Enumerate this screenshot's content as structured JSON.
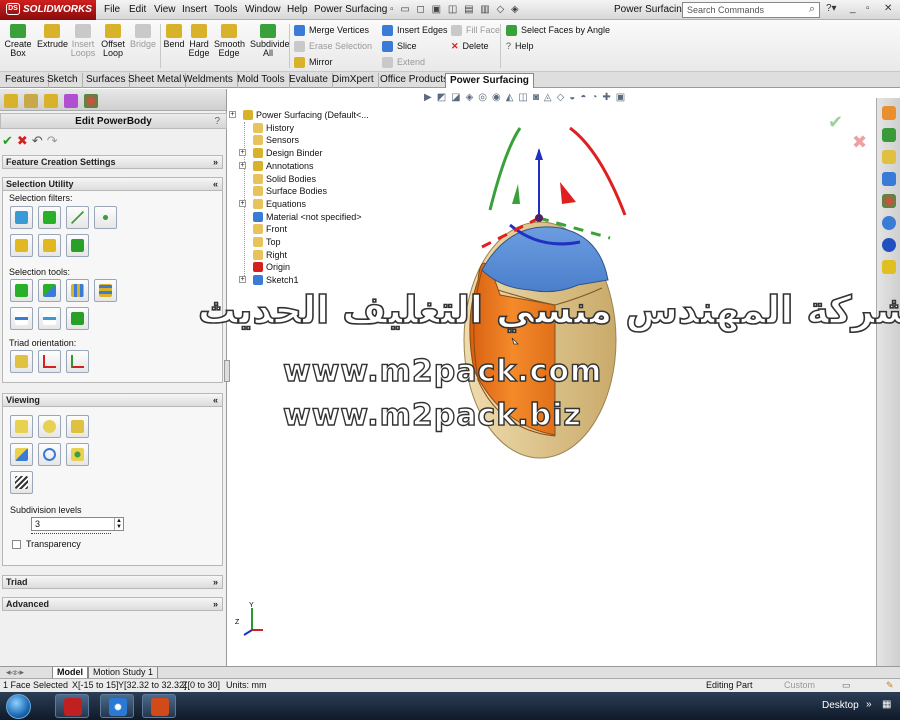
{
  "app": {
    "logo_text": "SOLIDWORKS",
    "document_title": "Power Surfacin...",
    "search_placeholder": "Search Commands",
    "menu": [
      "File",
      "Edit",
      "View",
      "Insert",
      "Tools",
      "Window",
      "Help",
      "Power Surfacing"
    ]
  },
  "commands": {
    "big": [
      {
        "label1": "Create",
        "label2": "Box",
        "disabled": false,
        "color": "#3aa03a"
      },
      {
        "label1": "Extrude",
        "label2": "",
        "disabled": false,
        "color": "#d8b22a"
      },
      {
        "label1": "Insert",
        "label2": "Loops",
        "disabled": true,
        "color": "#b5b5b5"
      },
      {
        "label1": "Offset",
        "label2": "Loop",
        "disabled": false,
        "color": "#d8b22a"
      },
      {
        "label1": "Bridge",
        "label2": "",
        "disabled": true,
        "color": "#b5b5b5"
      },
      {
        "label1": "Bend",
        "label2": "",
        "disabled": false,
        "color": "#d8b22a"
      },
      {
        "label1": "Hard",
        "label2": "Edge",
        "disabled": false,
        "color": "#d8b22a"
      },
      {
        "label1": "Smooth",
        "label2": "Edge",
        "disabled": false,
        "color": "#d8b22a"
      },
      {
        "label1": "Subdivide",
        "label2": "All",
        "disabled": false,
        "color": "#3aa03a"
      }
    ],
    "small": [
      {
        "label": "Merge Vertices",
        "disabled": false,
        "color": "#3a7bd5"
      },
      {
        "label": "Erase Selection",
        "disabled": true,
        "color": "#b5b5b5"
      },
      {
        "label": "Mirror",
        "disabled": false,
        "color": "#d8b22a"
      },
      {
        "label": "Insert Edges",
        "disabled": false,
        "color": "#3a7bd5"
      },
      {
        "label": "Slice",
        "disabled": false,
        "color": "#3a7bd5"
      },
      {
        "label": "Extend",
        "disabled": true,
        "color": "#b5b5b5"
      },
      {
        "label": "Fill Face",
        "disabled": true,
        "color": "#b5b5b5"
      },
      {
        "label": "Delete",
        "disabled": false,
        "color": "#d52020"
      },
      {
        "label": "Select Faces by Angle",
        "disabled": false,
        "color": "#3aa03a"
      },
      {
        "label": "Help",
        "disabled": false,
        "color": "#777777"
      }
    ]
  },
  "tabs": [
    "Features",
    "Sketch",
    "Surfaces",
    "Sheet Metal",
    "Weldments",
    "Mold Tools",
    "Evaluate",
    "DimXpert",
    "Office Products",
    "Power Surfacing"
  ],
  "active_tab": "Power Surfacing",
  "property_manager": {
    "title": "Edit PowerBody",
    "help": "?",
    "groups": {
      "feature_creation": "Feature Creation Settings",
      "selection_utility": "Selection Utility",
      "viewing": "Viewing",
      "triad": "Triad",
      "advanced": "Advanced"
    },
    "labels": {
      "selection_filters": "Selection filters:",
      "selection_tools": "Selection tools:",
      "triad_orientation": "Triad orientation:",
      "subdivision_levels": "Subdivision levels",
      "transparency": "Transparency"
    },
    "subdivision_value": "3",
    "transparency_checked": false
  },
  "feature_tree": [
    {
      "label": "Power Surfacing  (Default<...",
      "icon": "part-icon",
      "expandable": true,
      "color": "#d8b22a"
    },
    {
      "label": "History",
      "icon": "folder-icon",
      "expandable": false,
      "color": "#e8c25a"
    },
    {
      "label": "Sensors",
      "icon": "folder-icon",
      "expandable": false,
      "color": "#e8c25a"
    },
    {
      "label": "Design Binder",
      "icon": "binder-icon",
      "expandable": true,
      "color": "#d8b22a"
    },
    {
      "label": "Annotations",
      "icon": "annotation-icon",
      "expandable": true,
      "color": "#d8b22a"
    },
    {
      "label": "Solid Bodies",
      "icon": "folder-icon",
      "expandable": false,
      "color": "#e8c25a"
    },
    {
      "label": "Surface Bodies",
      "icon": "folder-icon",
      "expandable": false,
      "color": "#e8c25a"
    },
    {
      "label": "Equations",
      "icon": "equation-icon",
      "expandable": true,
      "color": "#e8c25a"
    },
    {
      "label": "Material <not specified>",
      "icon": "material-icon",
      "expandable": false,
      "color": "#3a7bd5"
    },
    {
      "label": "Front",
      "icon": "plane-icon",
      "expandable": false,
      "color": "#e8c25a"
    },
    {
      "label": "Top",
      "icon": "plane-icon",
      "expandable": false,
      "color": "#e8c25a"
    },
    {
      "label": "Right",
      "icon": "plane-icon",
      "expandable": false,
      "color": "#e8c25a"
    },
    {
      "label": "Origin",
      "icon": "origin-icon",
      "expandable": false,
      "color": "#d52020"
    },
    {
      "label": "Sketch1",
      "icon": "sketch-icon",
      "expandable": true,
      "color": "#3a7bd5"
    }
  ],
  "watermark": {
    "arabic": "شركة المهندس منسي التغليف الحديث",
    "url1": "www.m2pack.com",
    "url2": "www.m2pack.biz"
  },
  "bottom_tabs": [
    "Model",
    "Motion Study 1"
  ],
  "active_bottom_tab": "Model",
  "status": {
    "selection": "1 Face Selected",
    "x": "X[-15 to 15]",
    "y": "Y[32.32 to 32.32]",
    "z": "Z[0 to 30]",
    "units": "Units: mm",
    "mode": "Editing Part",
    "custom": "Custom"
  },
  "taskbar": {
    "desktop_label": "Desktop"
  },
  "colors": {
    "face_orange": "#f07a1e",
    "face_blue": "#5b8fd3",
    "face_tan": "#e3c98f",
    "triad_red": "#e02020",
    "triad_green": "#3aa03a",
    "triad_blue": "#2030c0"
  }
}
